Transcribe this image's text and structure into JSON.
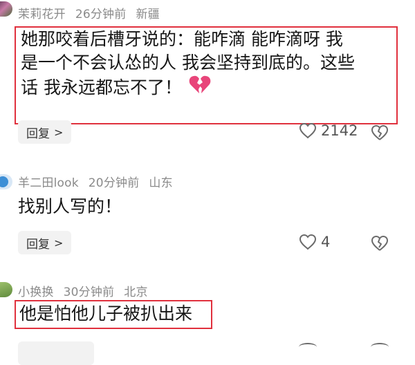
{
  "comments": [
    {
      "user": "茉莉花开",
      "time": "26分钟前",
      "location": "新疆",
      "lines": [
        "她那咬着后槽牙说的：能咋滴 能咋滴呀 我",
        "是一个不会认怂的人 我会坚持到底的。这些",
        "话 我永远都忘不了！"
      ],
      "emoji": "broken-heart-icon",
      "reply_label": "回复",
      "likes": "2142"
    },
    {
      "user": "羊二田look",
      "time": "20分钟前",
      "location": "山东",
      "lines": [
        "找别人写的！"
      ],
      "reply_label": "回复",
      "likes": "4"
    },
    {
      "user": "小换换",
      "time": "30分钟前",
      "location": "北京",
      "lines": [
        "他是怕他儿子被扒出来"
      ]
    }
  ],
  "colors": {
    "highlight": "#e0303d",
    "meta": "#8a8a8a",
    "broken_heart": "#e8457a"
  }
}
